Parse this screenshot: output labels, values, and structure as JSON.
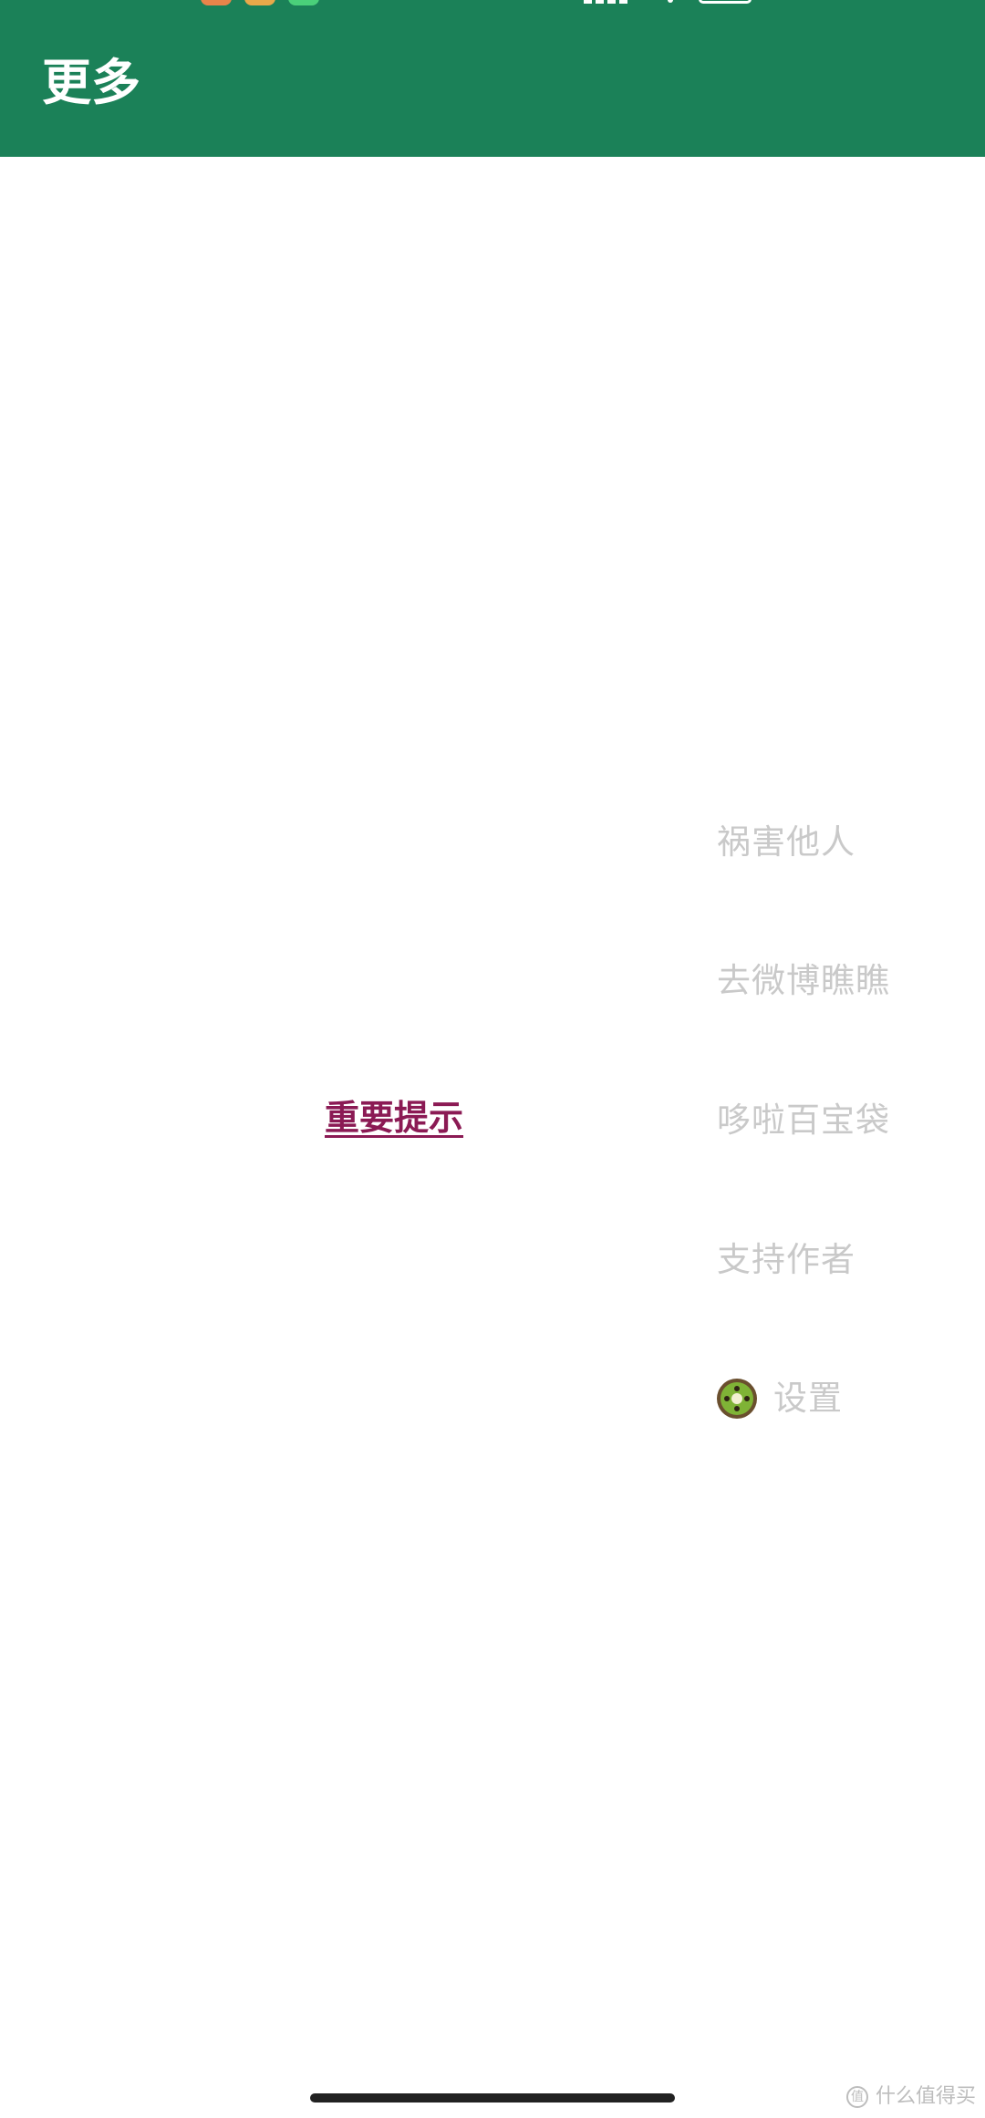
{
  "app_bar": {
    "title": "更多",
    "background_color": "#1b8158"
  },
  "content": {
    "notice_link": "重要提示",
    "notice_color": "#8b1a54"
  },
  "side_menu": {
    "items": [
      {
        "label": "祸害他人"
      },
      {
        "label": "去微博瞧瞧"
      },
      {
        "label": "哆啦百宝袋"
      },
      {
        "label": "支持作者"
      },
      {
        "label": "设置",
        "icon": "kiwi-icon"
      }
    ],
    "text_color": "#c9c9c9"
  },
  "watermark": {
    "text": "什么值得买"
  }
}
